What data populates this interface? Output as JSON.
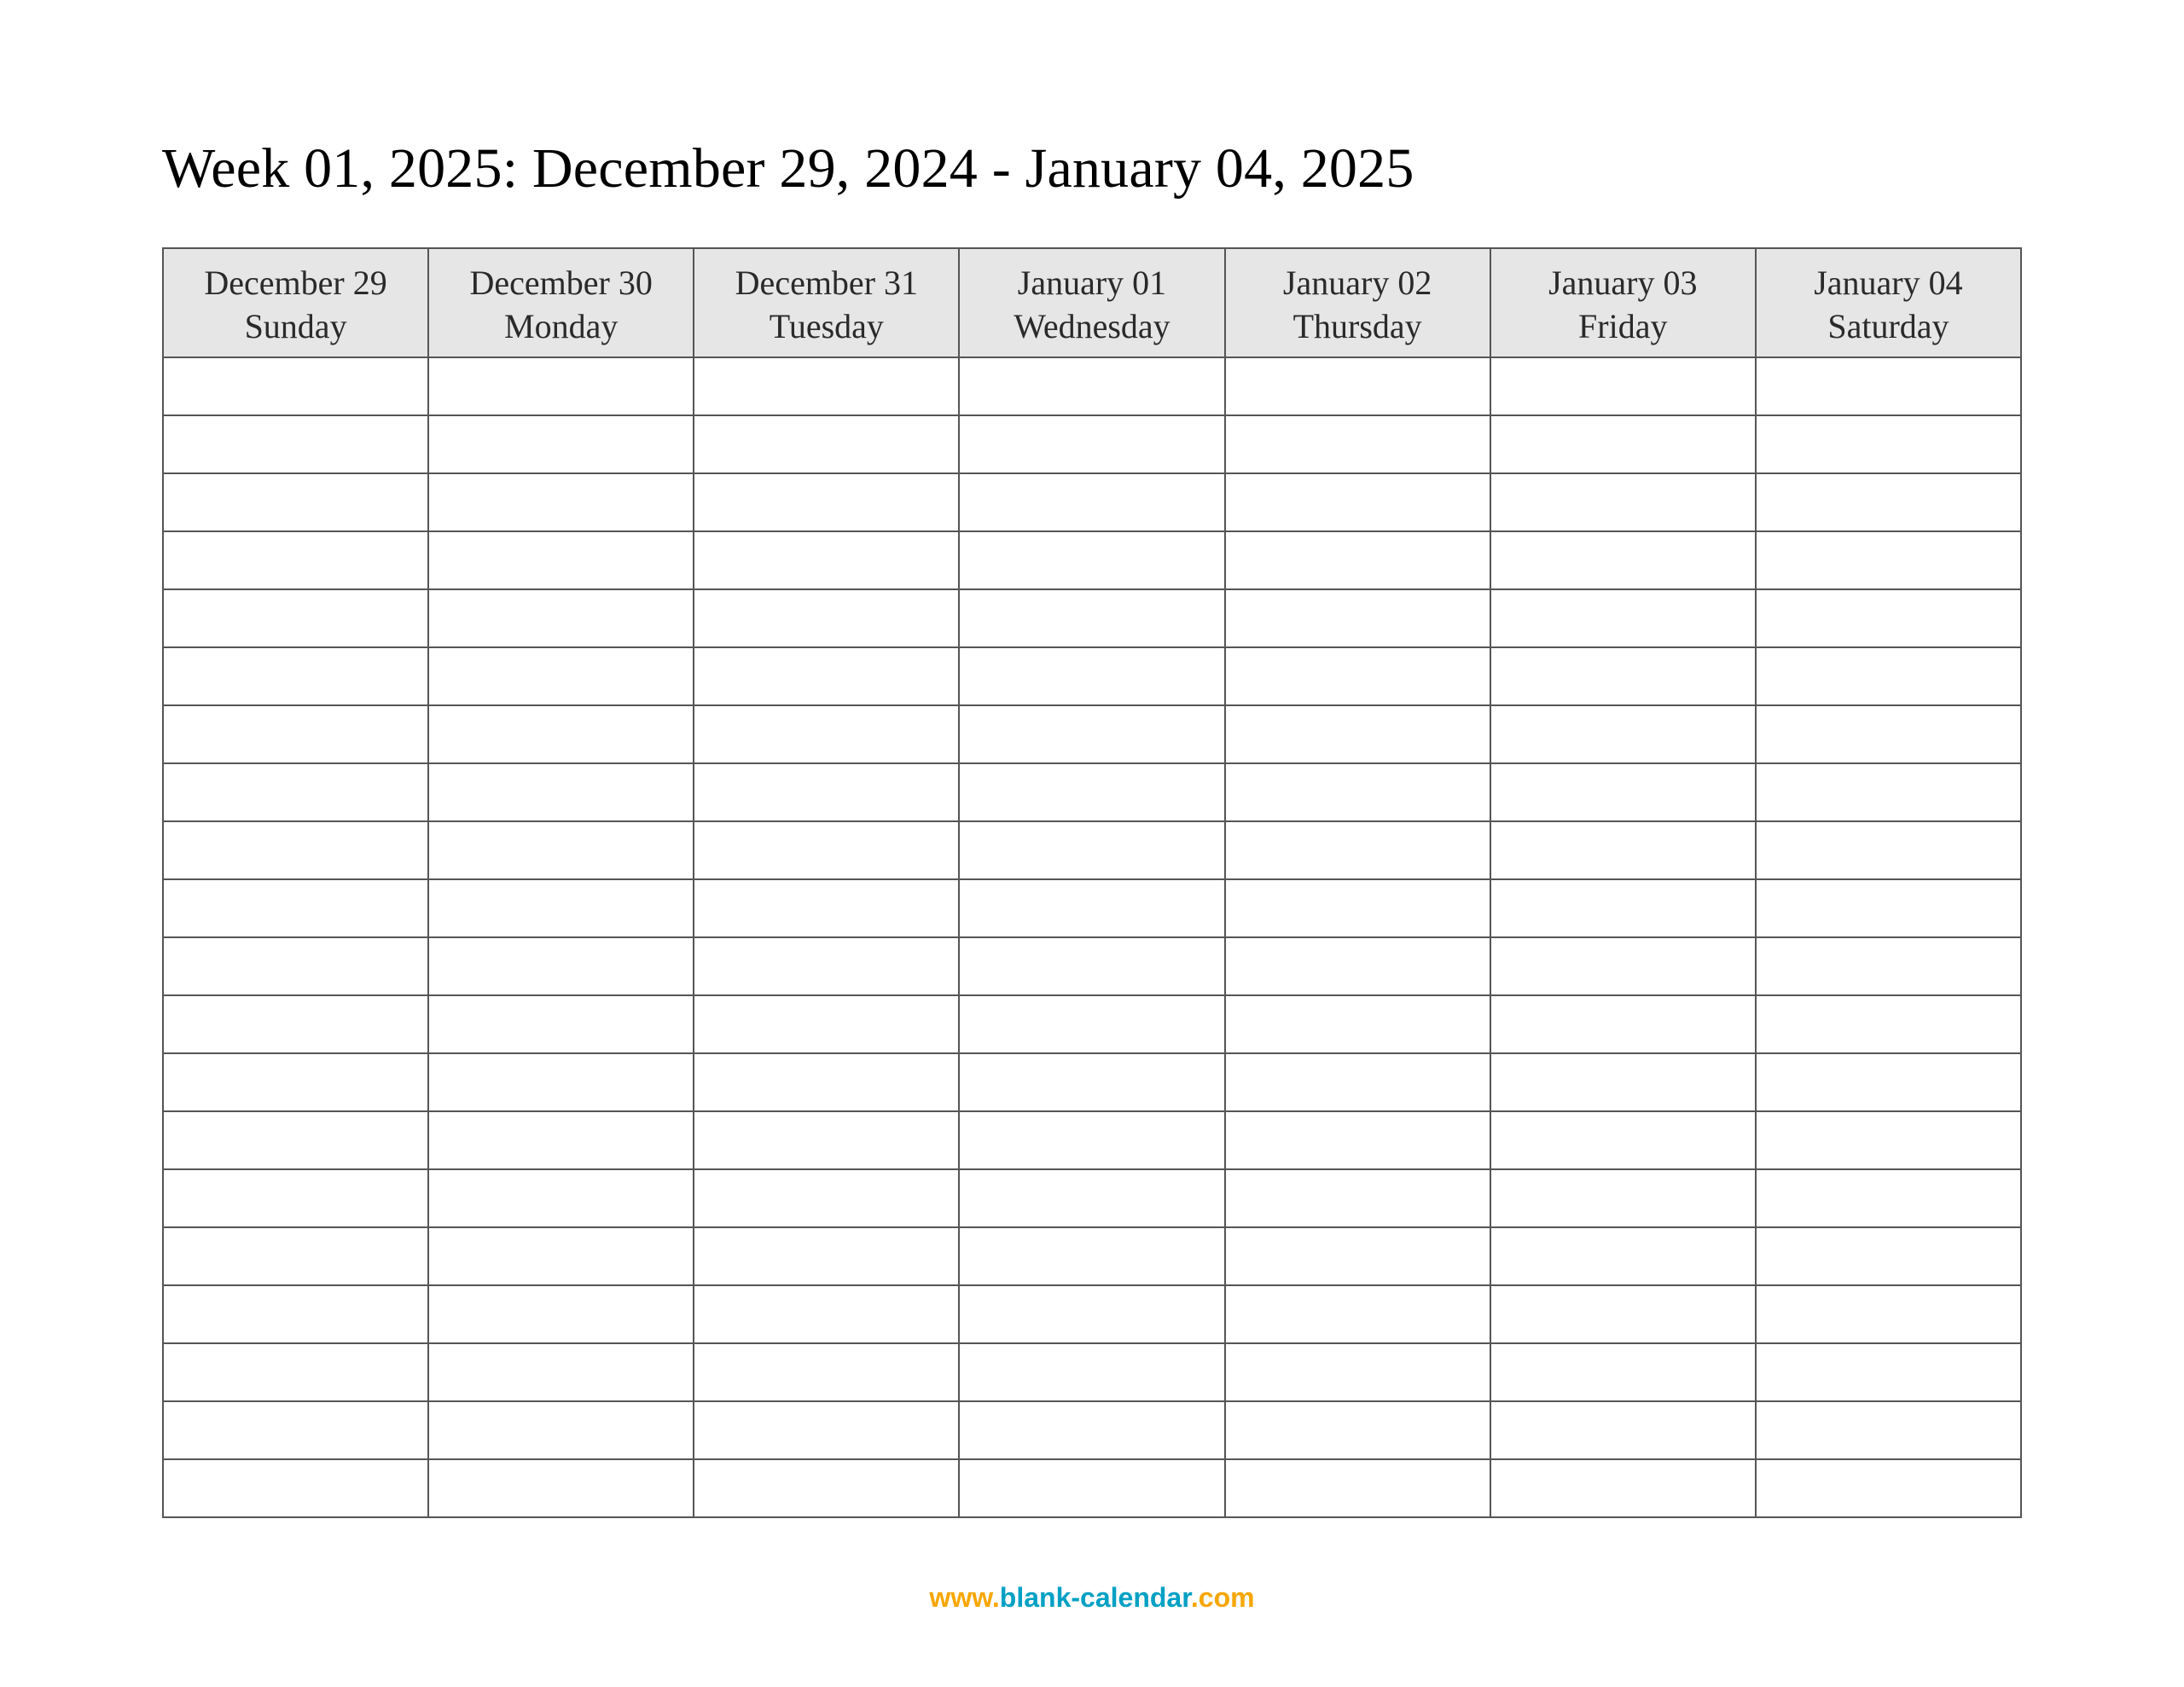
{
  "title": "Week 01, 2025: December 29, 2024 - January 04, 2025",
  "days": [
    {
      "date": "December 29",
      "weekday": "Sunday"
    },
    {
      "date": "December 30",
      "weekday": "Monday"
    },
    {
      "date": "December 31",
      "weekday": "Tuesday"
    },
    {
      "date": "January 01",
      "weekday": "Wednesday"
    },
    {
      "date": "January 02",
      "weekday": "Thursday"
    },
    {
      "date": "January 03",
      "weekday": "Friday"
    },
    {
      "date": "January 04",
      "weekday": "Saturday"
    }
  ],
  "blank_rows": 20,
  "footer": {
    "prefix": "www.",
    "main": "blank-calendar",
    "suffix": ".com"
  }
}
